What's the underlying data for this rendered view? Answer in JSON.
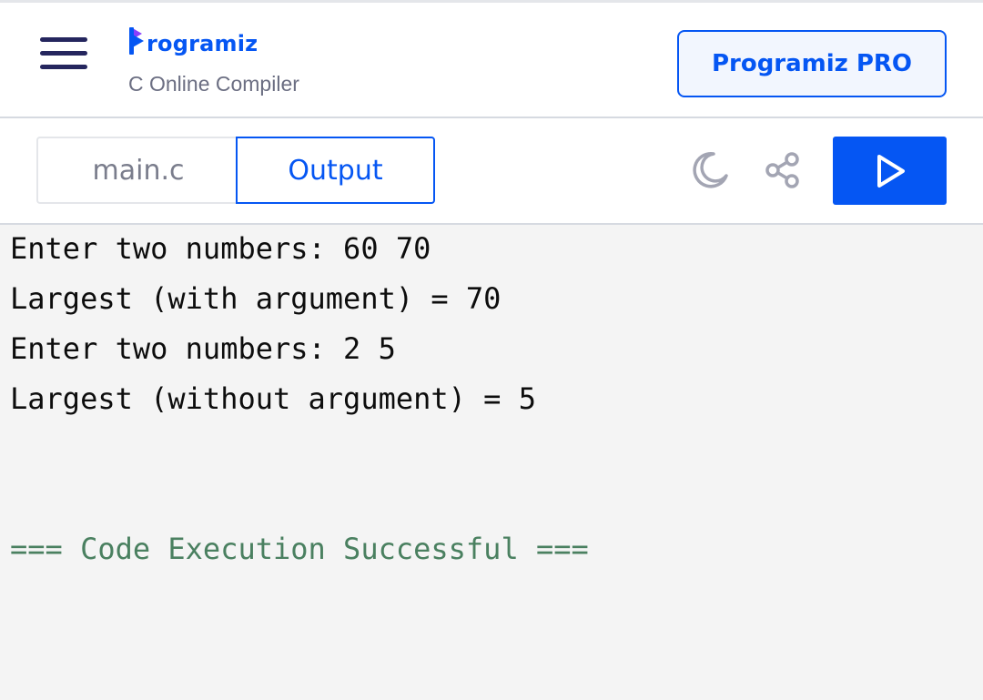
{
  "header": {
    "logo_text": "rogramiz",
    "subtitle": "C Online Compiler",
    "pro_button_label": "Programiz PRO"
  },
  "toolbar": {
    "tabs": [
      {
        "label": "main.c",
        "active": false
      },
      {
        "label": "Output",
        "active": true
      }
    ],
    "icons": [
      "moon-icon",
      "share-icon",
      "play-icon"
    ]
  },
  "output": {
    "lines": [
      "Enter two numbers: 60 70",
      "Largest (with argument) = 70",
      "Enter two numbers: 2 5",
      "Largest (without argument) = 5"
    ],
    "status": "=== Code Execution Successful ==="
  },
  "colors": {
    "brand": "#0556f3",
    "menu": "#25265e",
    "success_text": "#4a8060",
    "output_bg": "#f4f4f4"
  }
}
